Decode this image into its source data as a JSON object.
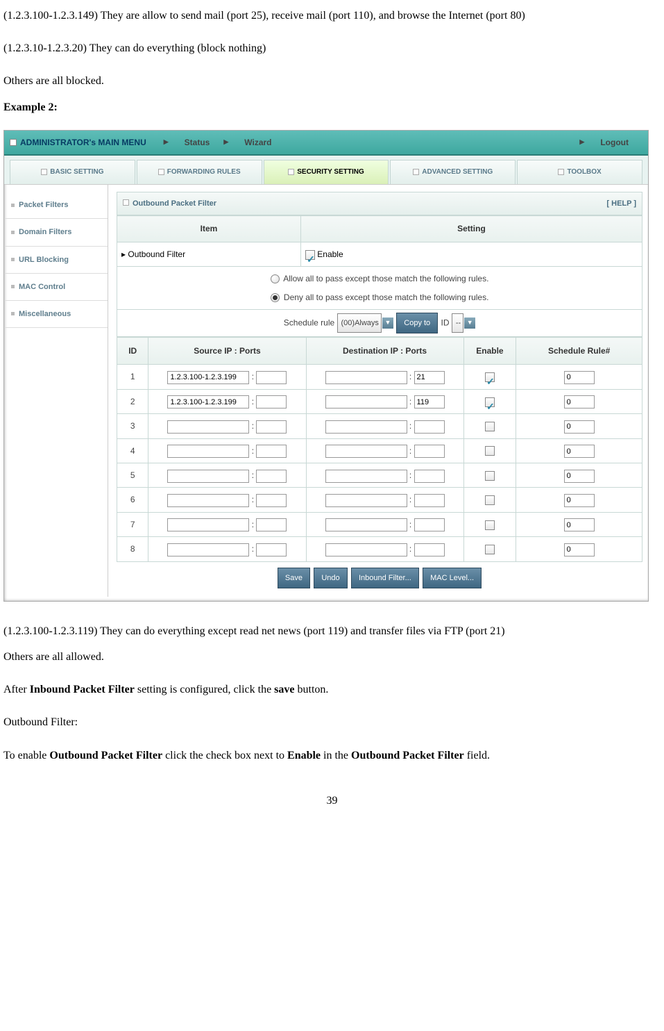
{
  "doc": {
    "p1": "(1.2.3.100-1.2.3.149) They are allow to send mail (port 25), receive mail (port 110), and browse the Internet (port 80)",
    "p2": "(1.2.3.10-1.2.3.20) They can do everything (block nothing)",
    "p3": "Others are all blocked.",
    "ex2": "Example 2:",
    "p4": "(1.2.3.100-1.2.3.119) They can do everything except read net news (port 119) and transfer files via FTP (port 21)",
    "p5": "Others are all allowed.",
    "p6a": "After ",
    "p6b": "Inbound Packet Filter",
    "p6c": " setting is configured, click the ",
    "p6d": "save",
    "p6e": " button.",
    "p7": "Outbound Filter:",
    "p8a": "To enable ",
    "p8b": "Outbound Packet Filter",
    "p8c": " click the check box next to ",
    "p8d": "Enable",
    "p8e": " in the ",
    "p8f": "Outbound Packet Filter",
    "p8g": " field.",
    "pagenum": "39"
  },
  "router": {
    "topbar": {
      "title": "ADMINISTRATOR's MAIN MENU",
      "status": "Status",
      "wizard": "Wizard",
      "logout": "Logout"
    },
    "tabs": {
      "basic": "BASIC SETTING",
      "forwarding": "FORWARDING RULES",
      "security": "SECURITY SETTING",
      "advanced": "ADVANCED SETTING",
      "toolbox": "TOOLBOX"
    },
    "sidebar": {
      "i0": "Packet Filters",
      "i1": "Domain Filters",
      "i2": "URL Blocking",
      "i3": "MAC Control",
      "i4": "Miscellaneous"
    },
    "panel": {
      "title": "Outbound Packet Filter",
      "help": "[ HELP ]",
      "col_item": "Item",
      "col_setting": "Setting",
      "item_outbound": "Outbound Filter",
      "enable_label": "Enable",
      "rule_allow": "Allow all to pass except those match the following rules.",
      "rule_deny": "Deny all to pass except those match the following rules.",
      "sched_label": "Schedule rule",
      "sched_val": "(00)Always",
      "copyto": "Copy to",
      "id_label": "ID",
      "id_sel": "--"
    },
    "rules": {
      "h_id": "ID",
      "h_src": "Source IP : Ports",
      "h_dst": "Destination IP : Ports",
      "h_en": "Enable",
      "h_sr": "Schedule Rule#",
      "rows": [
        {
          "id": "1",
          "sip": "1.2.3.100-1.2.3.199",
          "sport": "",
          "dip": "",
          "dport": "21",
          "en": true,
          "sr": "0"
        },
        {
          "id": "2",
          "sip": "1.2.3.100-1.2.3.199",
          "sport": "",
          "dip": "",
          "dport": "119",
          "en": true,
          "sr": "0"
        },
        {
          "id": "3",
          "sip": "",
          "sport": "",
          "dip": "",
          "dport": "",
          "en": false,
          "sr": "0"
        },
        {
          "id": "4",
          "sip": "",
          "sport": "",
          "dip": "",
          "dport": "",
          "en": false,
          "sr": "0"
        },
        {
          "id": "5",
          "sip": "",
          "sport": "",
          "dip": "",
          "dport": "",
          "en": false,
          "sr": "0"
        },
        {
          "id": "6",
          "sip": "",
          "sport": "",
          "dip": "",
          "dport": "",
          "en": false,
          "sr": "0"
        },
        {
          "id": "7",
          "sip": "",
          "sport": "",
          "dip": "",
          "dport": "",
          "en": false,
          "sr": "0"
        },
        {
          "id": "8",
          "sip": "",
          "sport": "",
          "dip": "",
          "dport": "",
          "en": false,
          "sr": "0"
        }
      ]
    },
    "buttons": {
      "save": "Save",
      "undo": "Undo",
      "inbound": "Inbound Filter...",
      "mac": "MAC Level..."
    }
  }
}
